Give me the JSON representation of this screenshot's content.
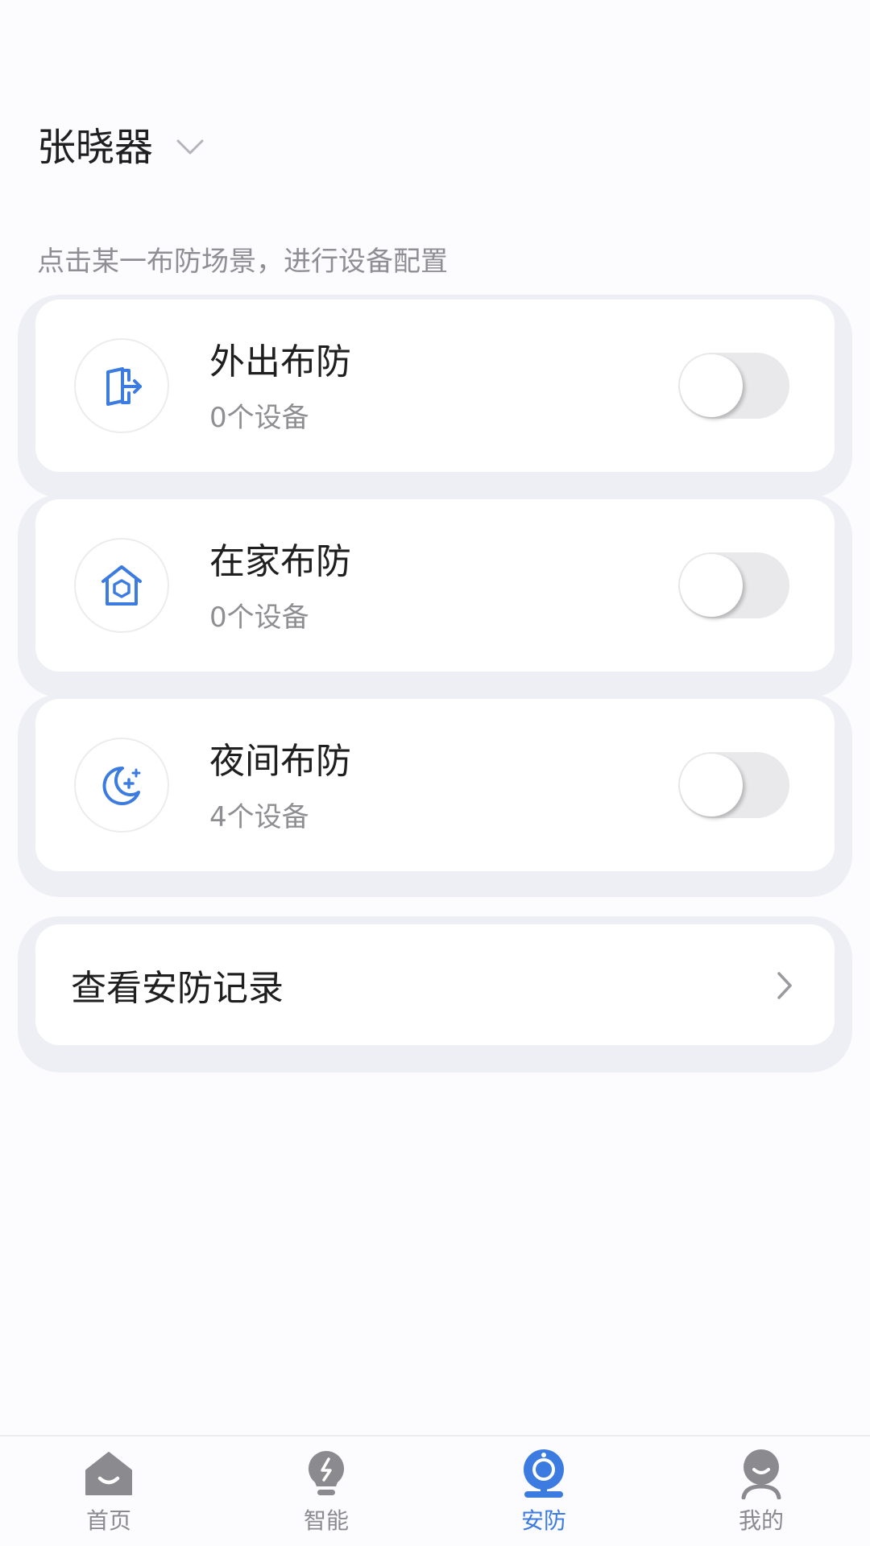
{
  "header": {
    "home_name": "张晓器"
  },
  "hint": "点击某一布防场景，进行设备配置",
  "scenes": [
    {
      "title": "外出布防",
      "count": "0个设备",
      "enabled": false,
      "icon": "door-exit-icon"
    },
    {
      "title": "在家布防",
      "count": "0个设备",
      "enabled": false,
      "icon": "home-shield-icon"
    },
    {
      "title": "夜间布防",
      "count": "4个设备",
      "enabled": false,
      "icon": "moon-star-icon"
    }
  ],
  "records": {
    "label": "查看安防记录"
  },
  "bottom_nav": [
    {
      "label": "首页",
      "icon": "home-icon",
      "active": false
    },
    {
      "label": "智能",
      "icon": "bulb-icon",
      "active": false
    },
    {
      "label": "安防",
      "icon": "camera-icon",
      "active": true
    },
    {
      "label": "我的",
      "icon": "person-icon",
      "active": false
    }
  ],
  "colors": {
    "accent": "#3C7BE0",
    "background": "#FCFCFF",
    "card": "#FFFFFF",
    "card_shadow": "#EEEFF4",
    "text_primary": "#1F1F1F",
    "text_secondary": "#8E8E93",
    "toggle_off": "#E9E9EB",
    "nav_inactive": "#8A8A8F"
  }
}
